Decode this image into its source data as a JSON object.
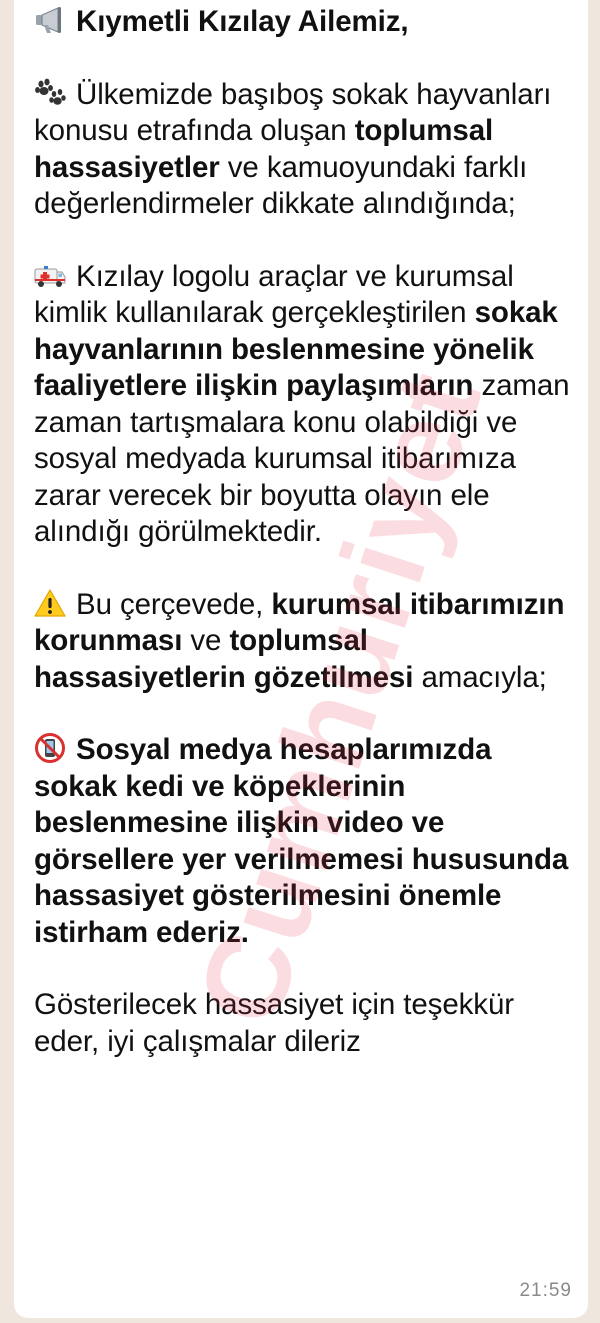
{
  "message": {
    "greeting": "Kıymetli Kızılay Ailemiz,",
    "p1_a": "Ülkemizde başıboş sokak hayvanları konusu etrafında oluşan ",
    "p1_b": "toplumsal hassasiyetler",
    "p1_c": " ve kamuoyundaki farklı değerlendirmeler dikkate alındığında;",
    "p2_a": "Kızılay logolu araçlar ve kurumsal kimlik kullanılarak gerçekleştirilen ",
    "p2_b": "sokak hayvanlarının beslenmesine yönelik faaliyetlere ilişkin paylaşımların",
    "p2_c": " zaman zaman tartışmalara konu olabildiği ve sosyal medyada kurumsal itibarımıza zarar verecek bir boyutta olayın ele alındığı görülmektedir.",
    "p3_a": "Bu çerçevede, ",
    "p3_b": "kurumsal itibarımızın korunması",
    "p3_c": " ve ",
    "p3_d": "toplumsal hassasiyetlerin gözetilmesi",
    "p3_e": " amacıyla;",
    "p4": "Sosyal medya hesaplarımızda sokak kedi ve köpeklerinin beslenmesine ilişkin video ve görsellere yer verilmemesi hususunda hassasiyet gösterilmesini önemle istirham ederiz.",
    "p5": "Gösterilecek hassasiyet için teşekkür eder, iyi çalışmalar dileriz",
    "time": "21:59"
  },
  "watermark": "Cumhuriyet",
  "icons": {
    "greeting": "megaphone-icon",
    "p1": "paw-prints-icon",
    "p2": "ambulance-icon",
    "p3": "warning-icon",
    "p4": "no-mobile-phones-icon"
  },
  "colors": {
    "bubble": "#ffffff",
    "background": "#efe7de",
    "watermark": "#e8283c",
    "timestamp": "#8a8a8a"
  }
}
